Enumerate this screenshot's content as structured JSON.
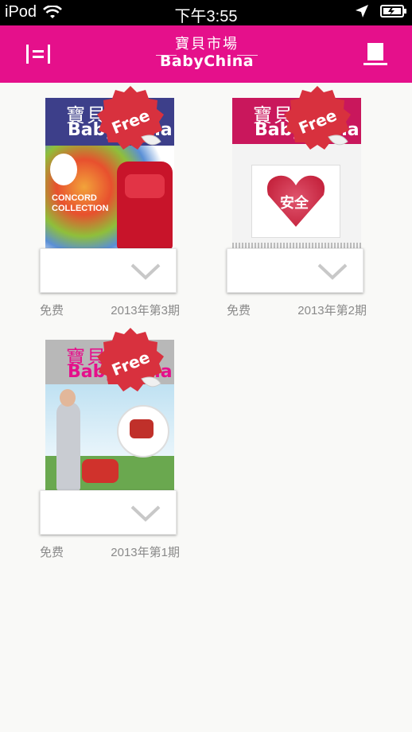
{
  "status_bar": {
    "carrier": "iPod",
    "time": "下午3:55"
  },
  "header": {
    "logo_cn": "寶貝市場",
    "logo_en": "BabyChina",
    "brand_color": "#e5108b"
  },
  "issues": [
    {
      "price": "免费",
      "date": "2013年第3期",
      "badge": "Free",
      "cover_text": "CONCORD COLLECTION"
    },
    {
      "price": "免费",
      "date": "2013年第2期",
      "badge": "Free",
      "cover_text": "安全"
    },
    {
      "price": "免费",
      "date": "2013年第1期",
      "badge": "Free",
      "cover_text": ""
    }
  ],
  "icons": {
    "menu": "menu-icon",
    "bookshelf": "bookshelf-icon",
    "download": "download-arrow-icon",
    "badge": "free-badge-icon"
  }
}
